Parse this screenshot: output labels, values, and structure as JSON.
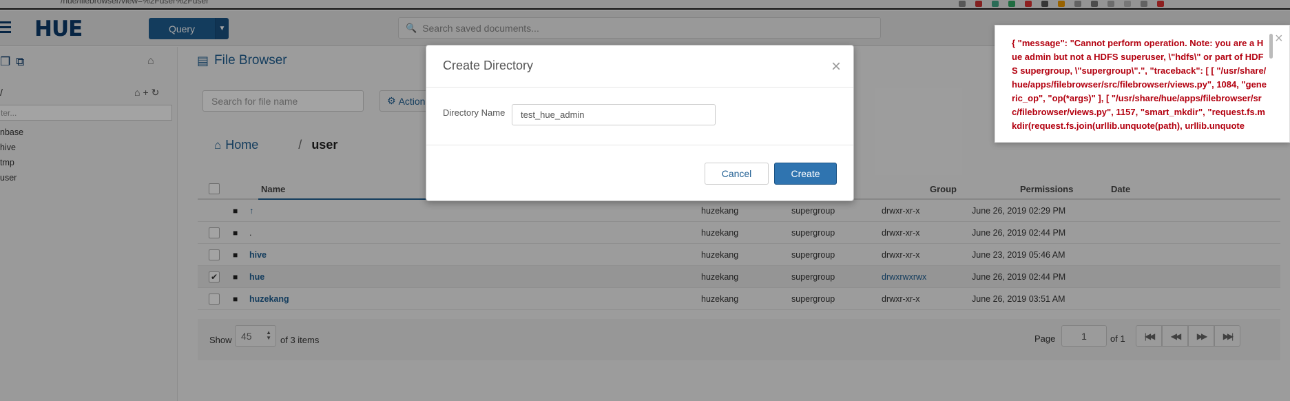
{
  "browser": {
    "url_fragment": "/hue/filebrowser/view=%2Fuser%2Fuser"
  },
  "navbar": {
    "logo": "HUE",
    "query_label": "Query",
    "search_placeholder": "Search saved documents..."
  },
  "sidebar": {
    "path": "/",
    "filter_placeholder": "ter...",
    "items": [
      "nbase",
      "hive",
      "tmp",
      "user"
    ]
  },
  "filebrowser": {
    "title": "File Browser",
    "search_placeholder": "Search for file name",
    "actions_label": "Action",
    "crumb_home": "Home",
    "crumb_sep": "/",
    "crumb_current": "user",
    "columns": {
      "name": "Name",
      "group": "Group",
      "permissions": "Permissions",
      "date": "Date"
    },
    "rows": [
      {
        "name": "↑",
        "user": "huzekang",
        "group": "supergroup",
        "perms": "drwxr-xr-x",
        "date": "June 26, 2019 02:29 PM",
        "checkbox": false,
        "checked": false,
        "link": true,
        "perm_link": false
      },
      {
        "name": ".",
        "user": "huzekang",
        "group": "supergroup",
        "perms": "drwxr-xr-x",
        "date": "June 26, 2019 02:44 PM",
        "checkbox": true,
        "checked": false,
        "link": false,
        "perm_link": false
      },
      {
        "name": "hive",
        "user": "huzekang",
        "group": "supergroup",
        "perms": "drwxr-xr-x",
        "date": "June 23, 2019 05:46 AM",
        "checkbox": true,
        "checked": false,
        "link": true,
        "perm_link": false
      },
      {
        "name": "hue",
        "user": "huzekang",
        "group": "supergroup",
        "perms": "drwxrwxrwx",
        "date": "June 26, 2019 02:44 PM",
        "checkbox": true,
        "checked": true,
        "link": true,
        "perm_link": true
      },
      {
        "name": "huzekang",
        "user": "huzekang",
        "group": "supergroup",
        "perms": "drwxr-xr-x",
        "date": "June 26, 2019 03:51 AM",
        "checkbox": true,
        "checked": false,
        "link": true,
        "perm_link": false
      }
    ],
    "pager": {
      "show_label": "Show",
      "page_size": "45",
      "items_label": "of 3 items",
      "page_label": "Page",
      "page_value": "1",
      "page_of": "of 1"
    }
  },
  "modal": {
    "title": "Create Directory",
    "field_label": "Directory Name",
    "field_value": "test_hue_admin",
    "cancel_label": "Cancel",
    "create_label": "Create"
  },
  "error_toast": {
    "message": "{ \"message\": \"Cannot perform operation. Note: you are a Hue admin but not a HDFS superuser, \\\"hdfs\\\" or part of HDFS supergroup, \\\"supergroup\\\".\", \"traceback\": [ [ \"/usr/share/hue/apps/filebrowser/src/filebrowser/views.py\", 1084, \"generic_op\", \"op(*args)\" ], [ \"/usr/share/hue/apps/filebrowser/src/filebrowser/views.py\", 1157, \"smart_mkdir\", \"request.fs.mkdir(request.fs.join(urllib.unquote(path), urllib.unquote"
  },
  "colors": {
    "primary": "#1f5e92",
    "logo": "#0b3b6b",
    "error": "#b3000f"
  }
}
